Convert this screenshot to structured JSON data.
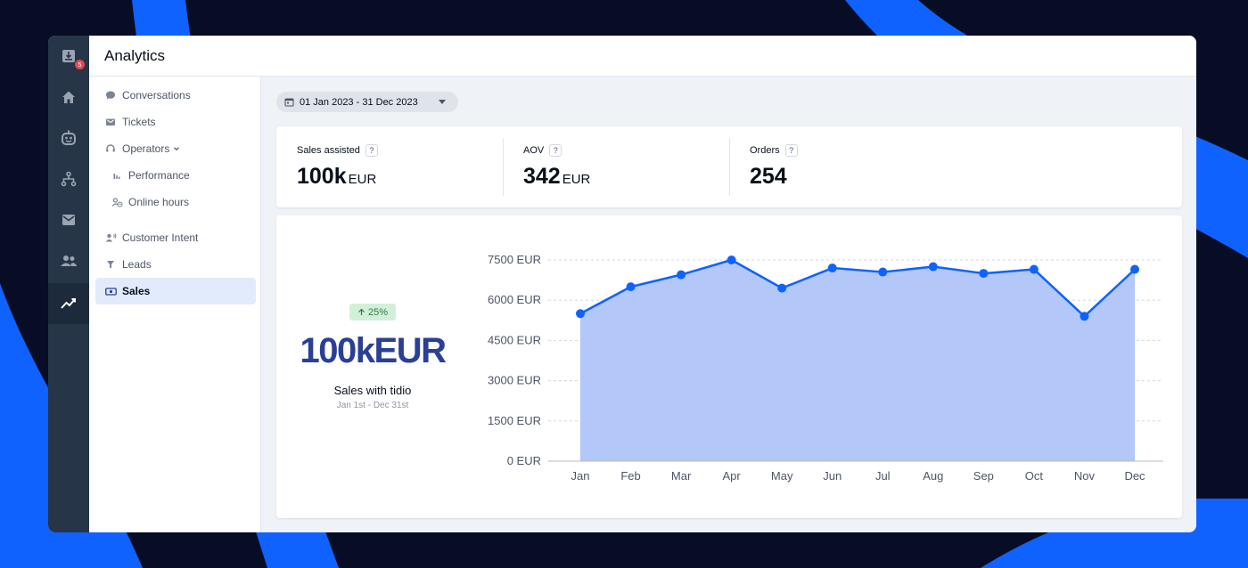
{
  "app": {
    "title": "Analytics",
    "notification_count": "5"
  },
  "icon_nav": [
    {
      "name": "inbox-icon",
      "active": false
    },
    {
      "name": "home-icon",
      "active": false
    },
    {
      "name": "bot-icon",
      "active": false
    },
    {
      "name": "flows-icon",
      "active": false
    },
    {
      "name": "mail-icon",
      "active": false
    },
    {
      "name": "contacts-icon",
      "active": false
    },
    {
      "name": "analytics-icon",
      "active": true
    }
  ],
  "sidebar": {
    "conversations": "Conversations",
    "tickets": "Tickets",
    "operators": "Operators",
    "performance": "Performance",
    "online_hours": "Online hours",
    "customer_intent": "Customer Intent",
    "leads": "Leads",
    "sales": "Sales",
    "selected": "Sales"
  },
  "date_range": "01 Jan 2023 - 31 Dec 2023",
  "stats": {
    "help_glyph": "?",
    "sales_assisted": {
      "label": "Sales assisted",
      "value": "100k",
      "unit": "EUR"
    },
    "aov": {
      "label": "AOV",
      "value": "342",
      "unit": "EUR"
    },
    "orders": {
      "label": "Orders",
      "value": "254"
    }
  },
  "summary": {
    "growth": "25%",
    "total": "100kEUR",
    "label": "Sales with tidio",
    "range": "Jan 1st - Dec 31st"
  },
  "colors": {
    "accent": "#0f62fe",
    "area_fill": "#b3c7f9",
    "highlight": "#2a3f96",
    "sidebar_dark": "#263548"
  },
  "chart_data": {
    "type": "area",
    "categories": [
      "Jan",
      "Feb",
      "Mar",
      "Apr",
      "May",
      "Jun",
      "Jul",
      "Aug",
      "Sep",
      "Oct",
      "Nov",
      "Dec"
    ],
    "series": [
      {
        "values": [
          5500,
          6500,
          6950,
          7500,
          6450,
          7200,
          7050,
          7250,
          7000,
          7150,
          5400,
          7150
        ]
      }
    ],
    "y_ticks": [
      "0 EUR",
      "1500 EUR",
      "3000 EUR",
      "4500 EUR",
      "6000 EUR",
      "7500 EUR"
    ],
    "y_tick_values": [
      0,
      1500,
      3000,
      4500,
      6000,
      7500
    ],
    "ylim": [
      0,
      7500
    ],
    "grid": true,
    "xlabel": "",
    "ylabel": ""
  }
}
